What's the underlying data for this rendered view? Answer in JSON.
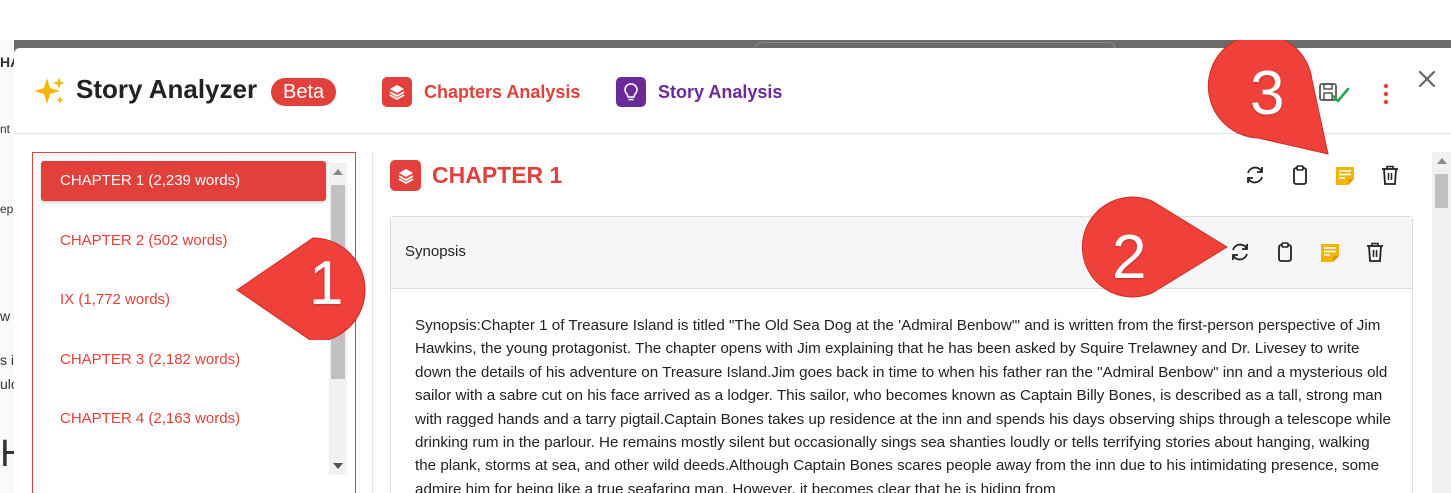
{
  "background": {
    "fragments": [
      "HA",
      "nt",
      "ep",
      "w",
      "s i",
      "ulc",
      "H"
    ]
  },
  "header": {
    "title": "Story Analyzer",
    "badge": "Beta",
    "tabs": [
      {
        "label": "Chapters Analysis",
        "icon": "layers-icon",
        "color": "#e2403a"
      },
      {
        "label": "Story Analysis",
        "icon": "lightbulb-icon",
        "color": "#6a2a9a"
      }
    ],
    "icons": [
      "sparkle-icon",
      "save-check-icon",
      "kebab-menu-icon",
      "close-icon"
    ]
  },
  "chapters": {
    "items": [
      {
        "label": "CHAPTER 1 (2,239 words)",
        "active": true
      },
      {
        "label": "CHAPTER 2 (502 words)",
        "active": false
      },
      {
        "label": "IX (1,772 words)",
        "active": false
      },
      {
        "label": "CHAPTER 3 (2,182 words)",
        "active": false
      },
      {
        "label": "CHAPTER 4 (2,163 words)",
        "active": false
      }
    ]
  },
  "content": {
    "chapter_title": "CHAPTER 1",
    "actions": [
      "refresh-icon",
      "clipboard-icon",
      "notes-icon",
      "trash-icon"
    ],
    "section": {
      "title": "Synopsis",
      "body": "Synopsis:Chapter 1 of Treasure Island is titled \"The Old Sea Dog at the 'Admiral Benbow'\" and is written from the first-person perspective of Jim Hawkins, the young protagonist. The chapter opens with Jim explaining that he has been asked by Squire Trelawney and Dr. Livesey to write down the details of his adventure on Treasure Island.Jim goes back in time to when his father ran the \"Admiral Benbow\" inn and a mysterious old sailor with a sabre cut on his face arrived as a lodger. This sailor, who becomes known as Captain Billy Bones, is described as a tall, strong man with ragged hands and a tarry pigtail.Captain Bones takes up residence at the inn and spends his days observing ships through a telescope while drinking rum in the parlour. He remains mostly silent but occasionally sings sea shanties loudly or tells terrifying stories about hanging, walking the plank, storms at sea, and other wild deeds.Although Captain Bones scares people away from the inn due to his intimidating presence, some admire him for being like a true seafaring man. However, it becomes clear that he is hiding from"
    }
  },
  "callouts": [
    "1",
    "2",
    "3"
  ],
  "colors": {
    "accent": "#e2403a",
    "purple": "#6a2a9a",
    "notes": "#f2b400",
    "callout": "#f0403a"
  }
}
